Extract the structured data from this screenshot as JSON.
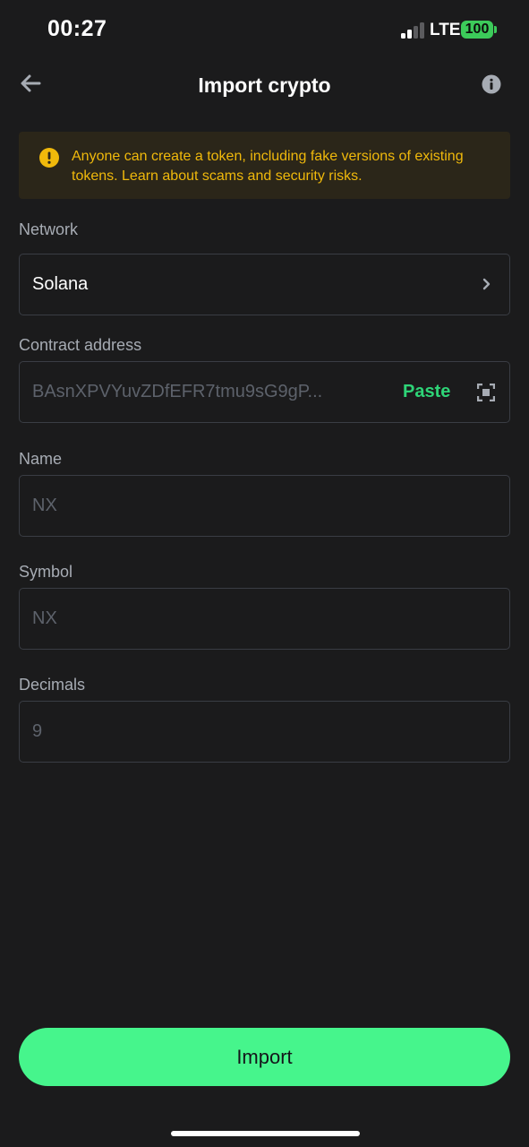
{
  "status_bar": {
    "time": "00:27",
    "network": "LTE",
    "battery": "100"
  },
  "header": {
    "title": "Import crypto",
    "back_icon": "arrow-left-icon",
    "info_icon": "info-icon"
  },
  "warning": {
    "icon": "exclamation-circle-icon",
    "text": "Anyone can create a token, including fake versions of existing tokens. Learn about scams and security risks.",
    "color": "#f0b90b"
  },
  "form": {
    "network": {
      "label": "Network",
      "value": "Solana"
    },
    "contract_address": {
      "label": "Contract address",
      "value": "BAsnXPVYuvZDfEFR7tmu9sG9gP...",
      "paste_label": "Paste",
      "scan_icon": "scan-icon"
    },
    "name": {
      "label": "Name",
      "value": "NX"
    },
    "symbol": {
      "label": "Symbol",
      "value": "NX"
    },
    "decimals": {
      "label": "Decimals",
      "value": "9"
    }
  },
  "actions": {
    "import_label": "Import",
    "accent_color": "#46f58c"
  }
}
